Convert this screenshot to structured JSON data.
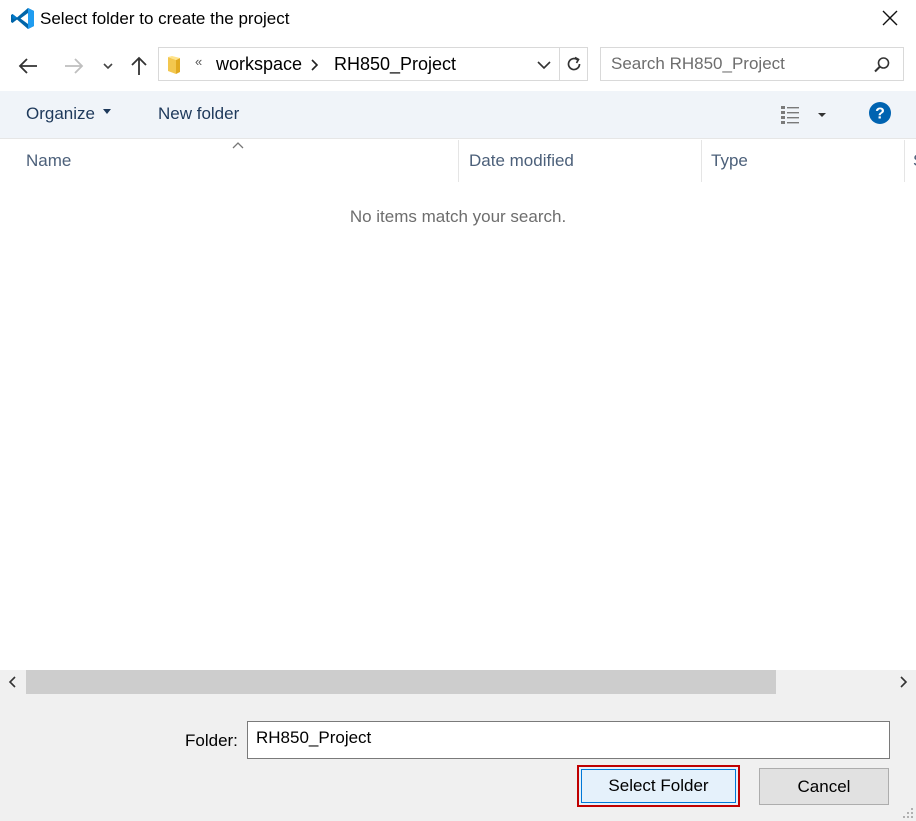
{
  "window": {
    "title": "Select folder to create the project",
    "brand_color": "#0078d7"
  },
  "nav": {
    "back_icon": "arrow-left-icon",
    "forward_icon": "arrow-right-icon",
    "recent_icon": "chevron-down-icon",
    "up_icon": "arrow-up-icon",
    "overflow": "«",
    "breadcrumbs": [
      "workspace",
      "RH850_Project"
    ],
    "refresh_icon": "refresh-icon"
  },
  "search": {
    "placeholder": "Search RH850_Project"
  },
  "toolbar": {
    "organize_label": "Organize",
    "new_folder_label": "New folder"
  },
  "columns": [
    "Name",
    "Date modified",
    "Type",
    "S"
  ],
  "list": {
    "empty_message": "No items match your search."
  },
  "footer": {
    "folder_label": "Folder:",
    "folder_value": "RH850_Project",
    "select_label": "Select Folder",
    "cancel_label": "Cancel"
  }
}
